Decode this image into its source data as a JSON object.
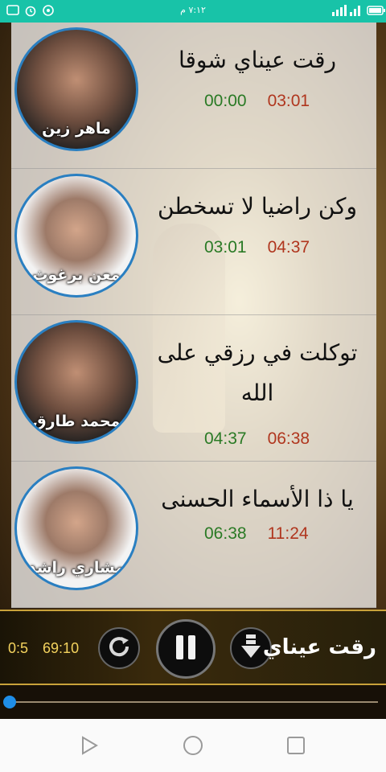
{
  "status_bar": {
    "time": "٧:١٢ م"
  },
  "songs": [
    {
      "title": "رقت عيناي شوقا",
      "artist": "ماهر زين",
      "start": "00:00",
      "end": "03:01"
    },
    {
      "title": "وكن راضيا لا تسخطن",
      "artist": "معن برغوث",
      "start": "03:01",
      "end": "04:37"
    },
    {
      "title": "توكلت في رزقي على الله",
      "artist": "محمد طارق",
      "start": "04:37",
      "end": "06:38"
    },
    {
      "title": "يا ذا الأسماء الحسنى",
      "artist": "مشاري راشد",
      "start": "06:38",
      "end": "11:24"
    }
  ],
  "player": {
    "elapsed": "0:5",
    "total": "69:10",
    "now_playing": "رقت عيناي",
    "progress_fraction": 0.001
  },
  "colors": {
    "status_bar": "#18c3a8",
    "start_time": "#2a7a25",
    "end_time": "#b0361e",
    "player_text": "#f4d35e",
    "progress_thumb": "#1f8ee8"
  },
  "icons": {
    "repeat": "repeat-icon",
    "pause": "pause-icon",
    "download": "download-icon",
    "nav_back": "back-triangle-icon",
    "nav_home": "home-circle-icon",
    "nav_recents": "recents-square-icon"
  }
}
